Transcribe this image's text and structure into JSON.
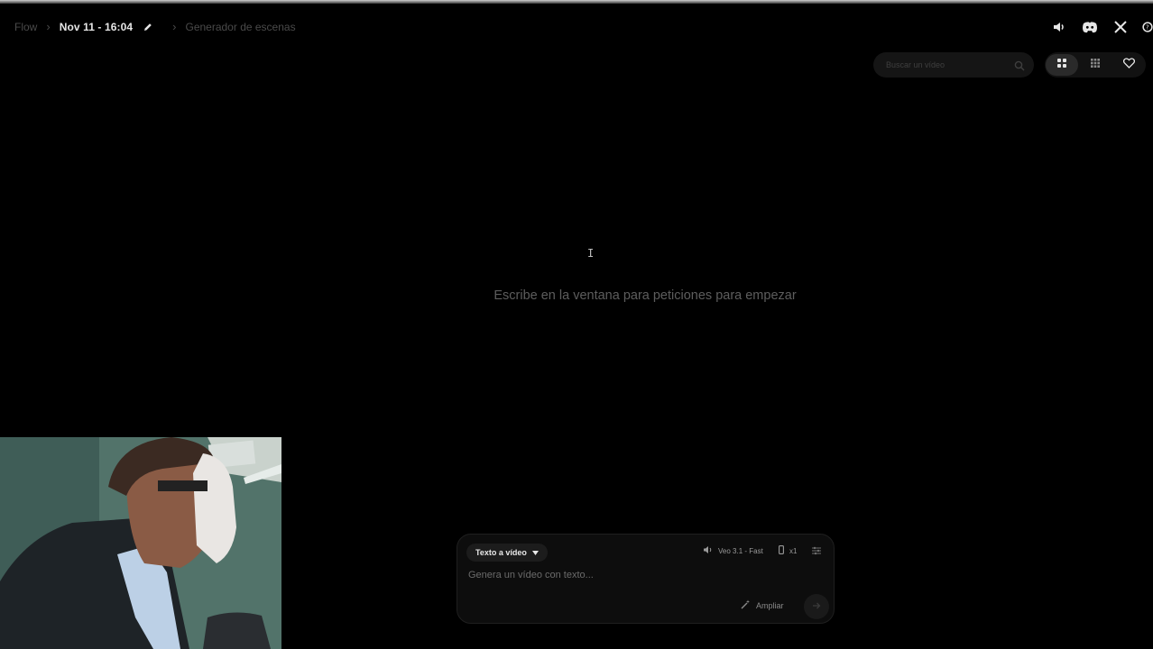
{
  "breadcrumb": {
    "root": "Flow",
    "project": "Nov 11 - 16:04",
    "section": "Generador de escenas"
  },
  "header_icons": [
    "speaker-icon",
    "discord-icon",
    "x-icon",
    "help-icon"
  ],
  "search": {
    "placeholder": "Buscar un vídeo"
  },
  "views": {
    "active": "grid-large"
  },
  "center": {
    "message": "Escribe en la ventana para peticiones para empezar"
  },
  "composer": {
    "mode_label": "Texto a vídeo",
    "model_label": "Veo 3.1 - Fast",
    "count_label": "x1",
    "prompt_placeholder": "Genera un vídeo con texto...",
    "expand_label": "Ampliar"
  },
  "colors": {
    "background": "#000000",
    "panel": "#0d0d0d",
    "text_dim": "#5d5d5d"
  }
}
